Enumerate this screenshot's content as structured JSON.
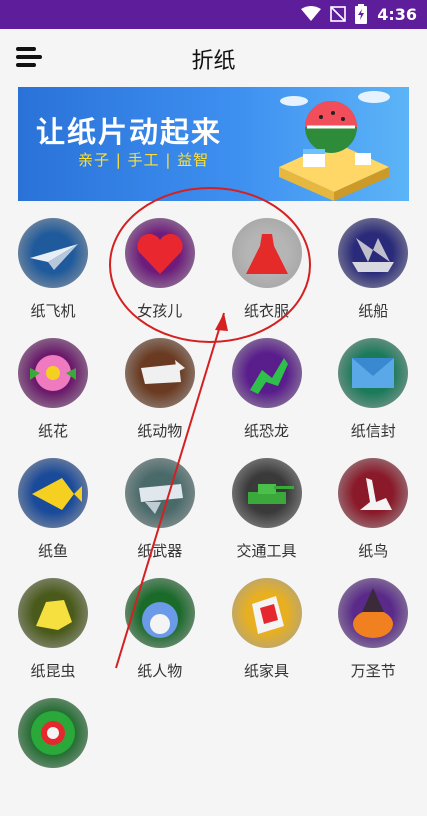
{
  "status_bar": {
    "time": "4:36"
  },
  "app": {
    "title": "折纸"
  },
  "banner": {
    "title": "让纸片动起来",
    "subtitle": "亲子 | 手工 | 益智"
  },
  "categories": [
    {
      "label": "纸飞机",
      "icon": "paper-plane-icon",
      "color": "#1f5a9c"
    },
    {
      "label": "女孩儿",
      "icon": "heart-icon",
      "color": "#6e1c7c"
    },
    {
      "label": "纸衣服",
      "icon": "dress-icon",
      "color": "#b5b5b5"
    },
    {
      "label": "纸船",
      "icon": "boat-icon",
      "color": "#2a2a7a"
    },
    {
      "label": "纸花",
      "icon": "flower-icon",
      "color": "#6a1a6a"
    },
    {
      "label": "纸动物",
      "icon": "animal-icon",
      "color": "#6a3b22"
    },
    {
      "label": "纸恐龙",
      "icon": "dinosaur-icon",
      "color": "#5a1e8c"
    },
    {
      "label": "纸信封",
      "icon": "envelope-icon",
      "color": "#1a7a5a"
    },
    {
      "label": "纸鱼",
      "icon": "fish-icon",
      "color": "#1a4a9a"
    },
    {
      "label": "纸武器",
      "icon": "weapon-icon",
      "color": "#4a6a6a"
    },
    {
      "label": "交通工具",
      "icon": "tank-icon",
      "color": "#3a3a3a"
    },
    {
      "label": "纸鸟",
      "icon": "swan-icon",
      "color": "#8a1a2a"
    },
    {
      "label": "纸昆虫",
      "icon": "frog-icon",
      "color": "#4a5a1a"
    },
    {
      "label": "纸人物",
      "icon": "totoro-icon",
      "color": "#1a6a2a"
    },
    {
      "label": "纸家具",
      "icon": "chair-icon",
      "color": "#e8b020"
    },
    {
      "label": "万圣节",
      "icon": "pumpkin-icon",
      "color": "#5a2a8a"
    },
    {
      "label": "",
      "icon": "christmas-wreath-icon",
      "color": "#1a6a2a"
    }
  ],
  "annotation": {
    "circle_color": "#d42020",
    "arrow_color": "#d42020"
  }
}
